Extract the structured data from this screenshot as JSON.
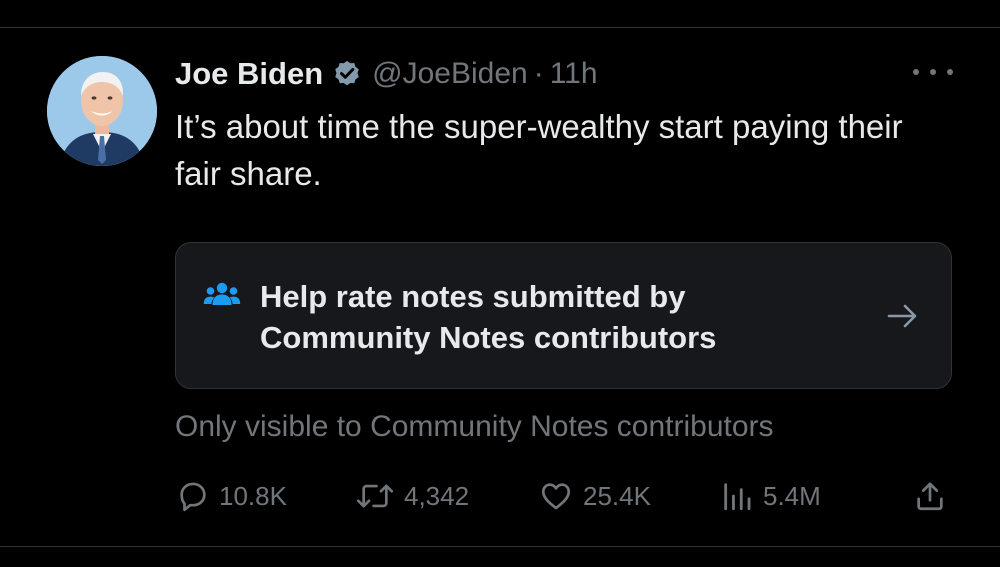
{
  "tweet": {
    "display_name": "Joe Biden",
    "handle": "@JoeBiden",
    "separator": "·",
    "time": "11h",
    "text": "It’s about time the super-wealthy start paying their fair share."
  },
  "community_note": {
    "prompt": "Help rate notes submitted by Community Notes contributors",
    "visibility": "Only visible to Community Notes contributors"
  },
  "actions": {
    "replies": "10.8K",
    "reposts": "4,342",
    "likes": "25.4K",
    "views": "5.4M"
  },
  "icons": {
    "verified": "verified-badge-icon",
    "more": "more-options-icon",
    "note": "community-notes-people-icon",
    "arrow": "arrow-right-icon",
    "reply": "reply-icon",
    "repost": "repost-icon",
    "like": "heart-icon",
    "views": "views-bar-chart-icon",
    "share": "share-icon"
  },
  "colors": {
    "background": "#000000",
    "primary_text": "#e7e9ea",
    "secondary_text": "#71767b",
    "accent_blue": "#1d9bf0",
    "verified_badge": "#829aab",
    "card_background": "#16181c",
    "border": "#2f3336"
  }
}
